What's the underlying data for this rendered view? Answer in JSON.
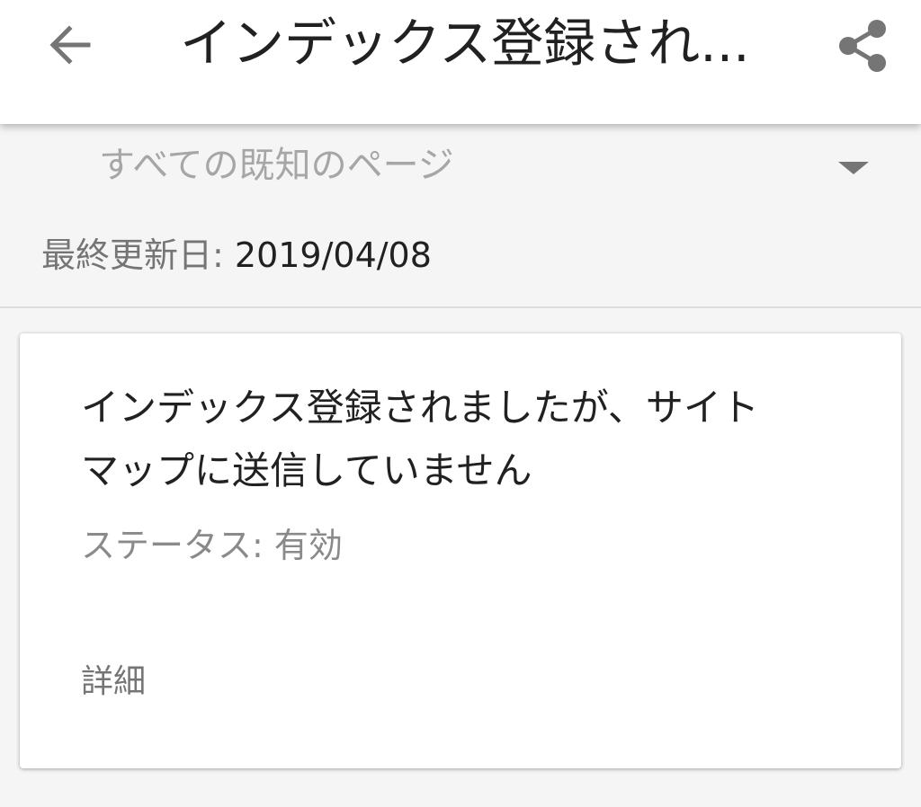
{
  "app_bar": {
    "title": "インデックス登録され...",
    "back_icon": "arrow-back-icon",
    "share_icon": "share-icon"
  },
  "filter": {
    "selected": "すべての既知のページ",
    "arrow_icon": "dropdown-arrow-icon"
  },
  "last_updated": {
    "label": "最終更新日: ",
    "value": "2019/04/08"
  },
  "card": {
    "title_line1": "インデックス登録されましたが、サイト",
    "title_line2": "マップに送信していません",
    "status": "ステータス: 有効",
    "detail_link": "詳細"
  },
  "colors": {
    "background": "#f5f5f5",
    "surface": "#ffffff",
    "primary_text": "#212121",
    "secondary_text": "#757575",
    "hint_text": "#a6a6a6",
    "icon": "#757575"
  }
}
